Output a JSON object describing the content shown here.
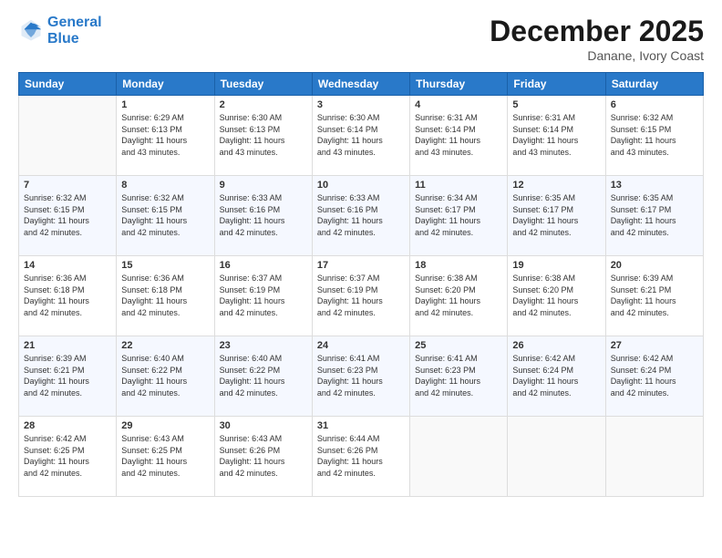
{
  "logo": {
    "line1": "General",
    "line2": "Blue"
  },
  "title": "December 2025",
  "location": "Danane, Ivory Coast",
  "days_header": [
    "Sunday",
    "Monday",
    "Tuesday",
    "Wednesday",
    "Thursday",
    "Friday",
    "Saturday"
  ],
  "weeks": [
    [
      {
        "num": "",
        "info": ""
      },
      {
        "num": "1",
        "info": "Sunrise: 6:29 AM\nSunset: 6:13 PM\nDaylight: 11 hours\nand 43 minutes."
      },
      {
        "num": "2",
        "info": "Sunrise: 6:30 AM\nSunset: 6:13 PM\nDaylight: 11 hours\nand 43 minutes."
      },
      {
        "num": "3",
        "info": "Sunrise: 6:30 AM\nSunset: 6:14 PM\nDaylight: 11 hours\nand 43 minutes."
      },
      {
        "num": "4",
        "info": "Sunrise: 6:31 AM\nSunset: 6:14 PM\nDaylight: 11 hours\nand 43 minutes."
      },
      {
        "num": "5",
        "info": "Sunrise: 6:31 AM\nSunset: 6:14 PM\nDaylight: 11 hours\nand 43 minutes."
      },
      {
        "num": "6",
        "info": "Sunrise: 6:32 AM\nSunset: 6:15 PM\nDaylight: 11 hours\nand 43 minutes."
      }
    ],
    [
      {
        "num": "7",
        "info": "Sunrise: 6:32 AM\nSunset: 6:15 PM\nDaylight: 11 hours\nand 42 minutes."
      },
      {
        "num": "8",
        "info": "Sunrise: 6:32 AM\nSunset: 6:15 PM\nDaylight: 11 hours\nand 42 minutes."
      },
      {
        "num": "9",
        "info": "Sunrise: 6:33 AM\nSunset: 6:16 PM\nDaylight: 11 hours\nand 42 minutes."
      },
      {
        "num": "10",
        "info": "Sunrise: 6:33 AM\nSunset: 6:16 PM\nDaylight: 11 hours\nand 42 minutes."
      },
      {
        "num": "11",
        "info": "Sunrise: 6:34 AM\nSunset: 6:17 PM\nDaylight: 11 hours\nand 42 minutes."
      },
      {
        "num": "12",
        "info": "Sunrise: 6:35 AM\nSunset: 6:17 PM\nDaylight: 11 hours\nand 42 minutes."
      },
      {
        "num": "13",
        "info": "Sunrise: 6:35 AM\nSunset: 6:17 PM\nDaylight: 11 hours\nand 42 minutes."
      }
    ],
    [
      {
        "num": "14",
        "info": "Sunrise: 6:36 AM\nSunset: 6:18 PM\nDaylight: 11 hours\nand 42 minutes."
      },
      {
        "num": "15",
        "info": "Sunrise: 6:36 AM\nSunset: 6:18 PM\nDaylight: 11 hours\nand 42 minutes."
      },
      {
        "num": "16",
        "info": "Sunrise: 6:37 AM\nSunset: 6:19 PM\nDaylight: 11 hours\nand 42 minutes."
      },
      {
        "num": "17",
        "info": "Sunrise: 6:37 AM\nSunset: 6:19 PM\nDaylight: 11 hours\nand 42 minutes."
      },
      {
        "num": "18",
        "info": "Sunrise: 6:38 AM\nSunset: 6:20 PM\nDaylight: 11 hours\nand 42 minutes."
      },
      {
        "num": "19",
        "info": "Sunrise: 6:38 AM\nSunset: 6:20 PM\nDaylight: 11 hours\nand 42 minutes."
      },
      {
        "num": "20",
        "info": "Sunrise: 6:39 AM\nSunset: 6:21 PM\nDaylight: 11 hours\nand 42 minutes."
      }
    ],
    [
      {
        "num": "21",
        "info": "Sunrise: 6:39 AM\nSunset: 6:21 PM\nDaylight: 11 hours\nand 42 minutes."
      },
      {
        "num": "22",
        "info": "Sunrise: 6:40 AM\nSunset: 6:22 PM\nDaylight: 11 hours\nand 42 minutes."
      },
      {
        "num": "23",
        "info": "Sunrise: 6:40 AM\nSunset: 6:22 PM\nDaylight: 11 hours\nand 42 minutes."
      },
      {
        "num": "24",
        "info": "Sunrise: 6:41 AM\nSunset: 6:23 PM\nDaylight: 11 hours\nand 42 minutes."
      },
      {
        "num": "25",
        "info": "Sunrise: 6:41 AM\nSunset: 6:23 PM\nDaylight: 11 hours\nand 42 minutes."
      },
      {
        "num": "26",
        "info": "Sunrise: 6:42 AM\nSunset: 6:24 PM\nDaylight: 11 hours\nand 42 minutes."
      },
      {
        "num": "27",
        "info": "Sunrise: 6:42 AM\nSunset: 6:24 PM\nDaylight: 11 hours\nand 42 minutes."
      }
    ],
    [
      {
        "num": "28",
        "info": "Sunrise: 6:42 AM\nSunset: 6:25 PM\nDaylight: 11 hours\nand 42 minutes."
      },
      {
        "num": "29",
        "info": "Sunrise: 6:43 AM\nSunset: 6:25 PM\nDaylight: 11 hours\nand 42 minutes."
      },
      {
        "num": "30",
        "info": "Sunrise: 6:43 AM\nSunset: 6:26 PM\nDaylight: 11 hours\nand 42 minutes."
      },
      {
        "num": "31",
        "info": "Sunrise: 6:44 AM\nSunset: 6:26 PM\nDaylight: 11 hours\nand 42 minutes."
      },
      {
        "num": "",
        "info": ""
      },
      {
        "num": "",
        "info": ""
      },
      {
        "num": "",
        "info": ""
      }
    ]
  ]
}
